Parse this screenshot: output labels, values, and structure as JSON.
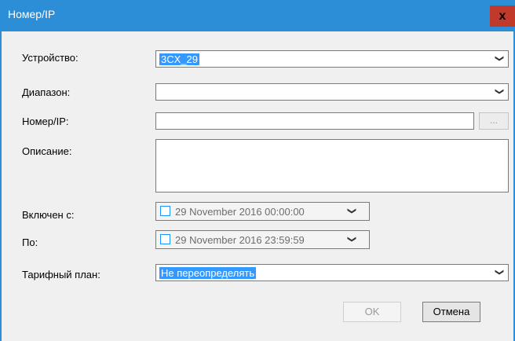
{
  "window": {
    "title": "Номер/IP",
    "close_label": "x"
  },
  "fields": {
    "device": {
      "label": "Устройство:",
      "value": "3CX_29"
    },
    "range": {
      "label": "Диапазон:",
      "value": ""
    },
    "number_ip": {
      "label": "Номер/IP:",
      "value": "",
      "browse_label": "..."
    },
    "description": {
      "label": "Описание:",
      "value": ""
    },
    "enabled_from": {
      "label": "Включен с:",
      "value": "29 November 2016 00:00:00",
      "checked": false
    },
    "to": {
      "label": "По:",
      "value": "29 November 2016 23:59:59",
      "checked": false
    },
    "tariff_plan": {
      "label": "Тарифный план:",
      "value": "Не переопределять"
    }
  },
  "buttons": {
    "ok": "OK",
    "cancel": "Отмена"
  },
  "icons": {
    "dropdown": "chevron-down-icon",
    "close": "close-icon"
  },
  "colors": {
    "titlebar": "#2b8ed6",
    "close": "#c0392b",
    "selection": "#3399ff"
  }
}
